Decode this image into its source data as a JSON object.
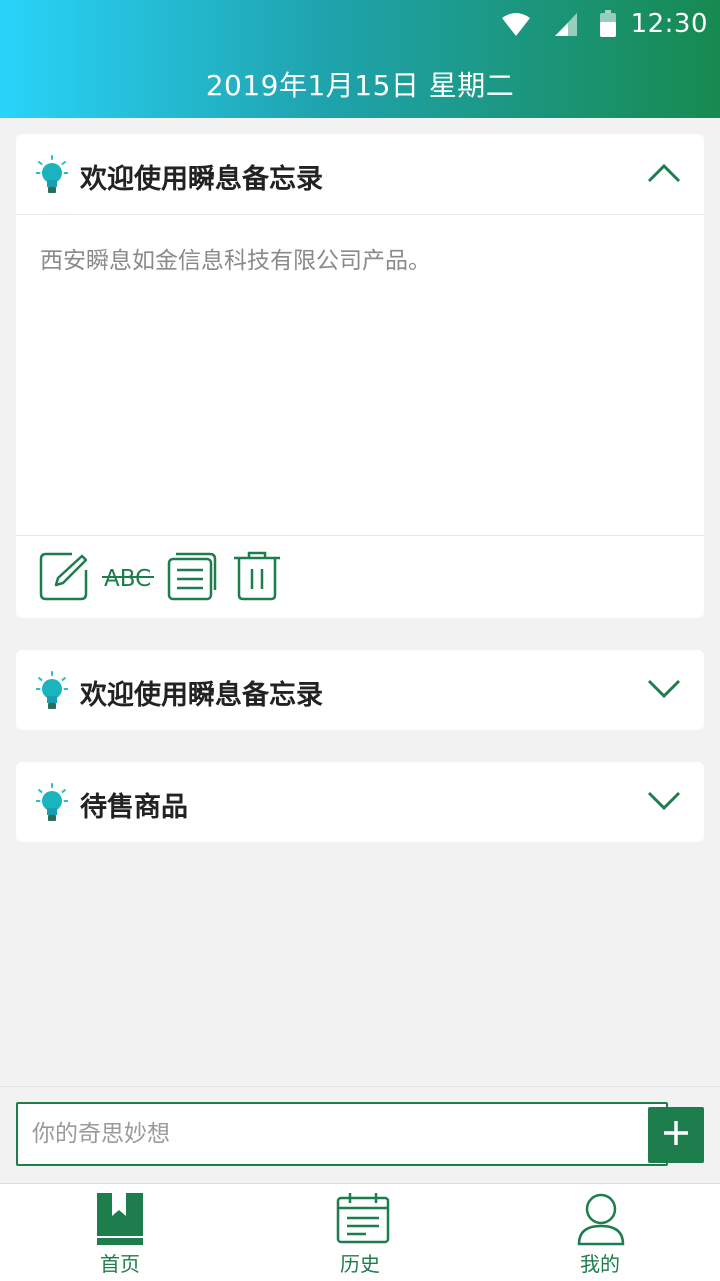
{
  "status_bar": {
    "time": "12:30",
    "icons": [
      "wifi-icon",
      "signal-icon",
      "battery-icon"
    ]
  },
  "header": {
    "date": "2019年1月15日 星期二"
  },
  "colors": {
    "accent": "#1e7d4d",
    "header_gradient": [
      "#29d3f9",
      "#178a50"
    ]
  },
  "memos": [
    {
      "title": "欢迎使用瞬息备忘录",
      "expanded": true,
      "content": "西安瞬息如金信息科技有限公司产品。",
      "tools": [
        {
          "name": "edit-icon"
        },
        {
          "name": "strikethrough-icon",
          "label": "ABC"
        },
        {
          "name": "copy-icon"
        },
        {
          "name": "trash-icon"
        }
      ]
    },
    {
      "title": "欢迎使用瞬息备忘录",
      "expanded": false
    },
    {
      "title": "待售商品",
      "expanded": false
    }
  ],
  "input": {
    "placeholder": "你的奇思妙想",
    "value": ""
  },
  "tabs": [
    {
      "label": "首页",
      "icon": "bookmark-icon",
      "active": true
    },
    {
      "label": "历史",
      "icon": "calendar-icon",
      "active": false
    },
    {
      "label": "我的",
      "icon": "user-icon",
      "active": false
    }
  ]
}
